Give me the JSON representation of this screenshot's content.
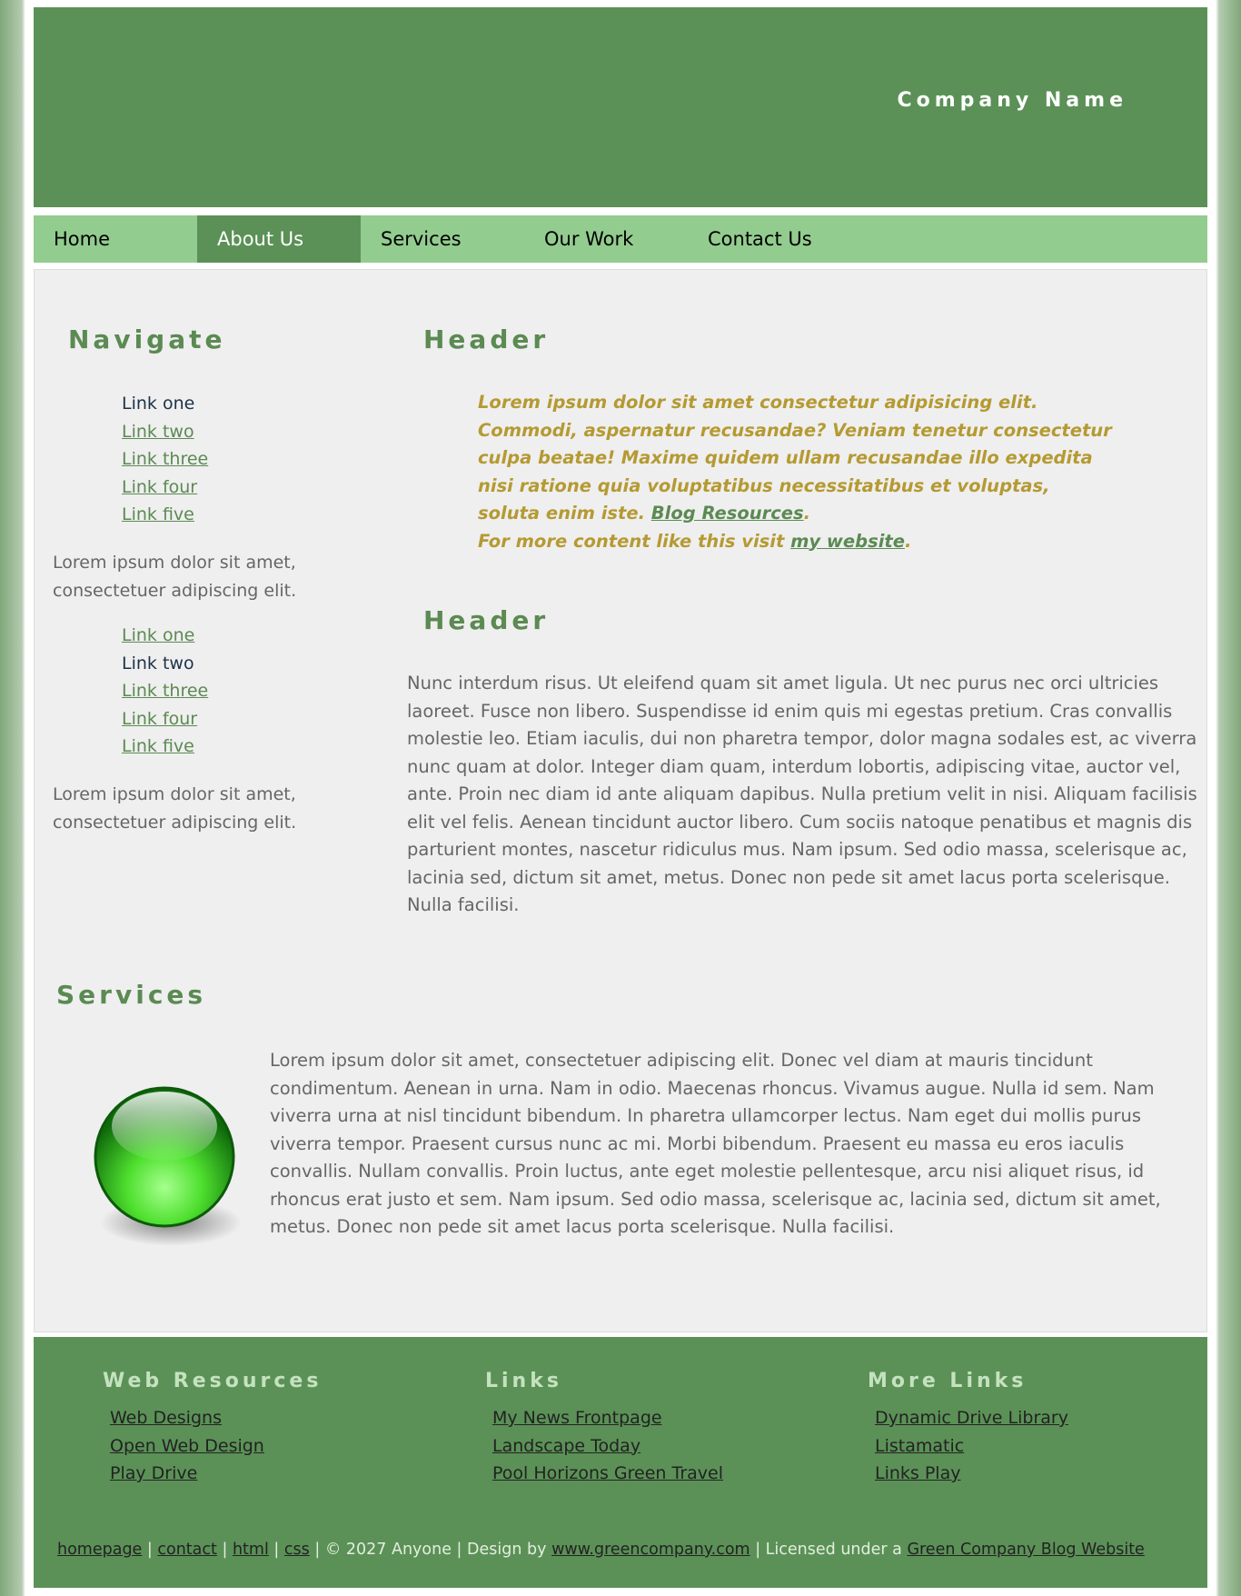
{
  "site": {
    "company_name": "Company Name"
  },
  "nav": {
    "items": [
      {
        "label": "Home"
      },
      {
        "label": "About Us"
      },
      {
        "label": "Services"
      },
      {
        "label": "Our Work"
      },
      {
        "label": "Contact Us"
      }
    ],
    "active": "About Us"
  },
  "sidebar": {
    "title": "Navigate",
    "group1": [
      "Link one",
      "Link two",
      "Link three",
      "Link four",
      "Link five"
    ],
    "text1": "Lorem ipsum dolor sit amet, consectetuer adipiscing elit.",
    "group2": [
      "Link one",
      "Link two",
      "Link three",
      "Link four",
      "Link five"
    ],
    "text2": "Lorem ipsum dolor sit amet, consectetuer adipiscing elit."
  },
  "main": {
    "header1": "Header",
    "quote": {
      "text": "Lorem ipsum dolor sit amet consectetur adipisicing elit. Commodi, aspernatur recusandae? Veniam tenetur consectetur culpa beatae! Maxime quidem ullam recusandae illo expedita nisi ratione quia voluptatibus necessitatibus et voluptas, soluta enim iste.",
      "link1": "Blog Resources",
      "more_prefix": "For more content like this visit",
      "link2": "my website"
    },
    "header2": "Header",
    "paragraph": "Nunc interdum risus. Ut eleifend quam sit amet ligula. Ut nec purus nec orci ultricies laoreet. Fusce non libero. Suspendisse id enim quis mi egestas pretium. Cras convallis molestie leo. Etiam iaculis, dui non pharetra tempor, dolor magna sodales est, ac viverra nunc quam at dolor. Integer diam quam, interdum lobortis, adipiscing vitae, auctor vel, ante. Proin nec diam id ante aliquam dapibus. Nulla pretium velit in nisi. Aliquam facilisis elit vel felis. Aenean tincidunt auctor libero. Cum sociis natoque penatibus et magnis dis parturient montes, nascetur ridiculus mus. Nam ipsum. Sed odio massa, scelerisque ac, lacinia sed, dictum sit amet, metus. Donec non pede sit amet lacus porta scelerisque. Nulla facilisi."
  },
  "services": {
    "title": "Services",
    "text": "Lorem ipsum dolor sit amet, consectetuer adipiscing elit. Donec vel diam at mauris tincidunt condimentum. Aenean in urna. Nam in odio. Maecenas rhoncus. Vivamus augue. Nulla id sem. Nam viverra urna at nisl tincidunt bibendum. In pharetra ullamcorper lectus. Nam eget dui mollis purus viverra tempor. Praesent cursus nunc ac mi. Morbi bibendum. Praesent eu massa eu eros iaculis convallis. Nullam convallis. Proin luctus, ante eget molestie pellentesque, arcu nisi aliquet risus, id rhoncus erat justo et sem. Nam ipsum. Sed odio massa, scelerisque ac, lacinia sed, dictum sit amet, metus. Donec non pede sit amet lacus porta scelerisque. Nulla facilisi.",
    "icon": "green-orb-icon"
  },
  "footer": {
    "col1": {
      "title": "Web Resources",
      "links": [
        "Web Designs",
        "Open Web Design",
        "Play Drive"
      ]
    },
    "col2": {
      "title": "Links",
      "links": [
        "My News Frontpage",
        "Landscape Today",
        "Pool Horizons Green Travel"
      ]
    },
    "col3": {
      "title": "More Links",
      "links": [
        "Dynamic Drive Library",
        "Listamatic",
        "Links Play"
      ]
    },
    "bottom": {
      "homepage": "homepage",
      "contact": "contact",
      "html": "html",
      "css": "css",
      "separator": "|",
      "copyright": "© 2027 Anyone",
      "design_by": "Design by",
      "design_link": "www.greencompany.com",
      "licensed": "Licensed under a",
      "license_link": "Green Company Blog Website"
    }
  },
  "colors": {
    "brand_green": "#5b9157",
    "nav_light_green": "#93cc8f",
    "quote_gold": "#b59a33",
    "heading_green": "#5b8a52"
  }
}
